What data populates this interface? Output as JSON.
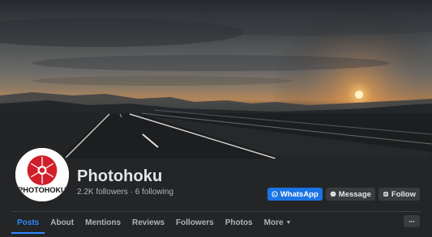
{
  "page": {
    "name": "Photohoku",
    "followers": "2.2K followers",
    "separator": "·",
    "following": "6 following",
    "avatar_text": "PHOTOHOKU"
  },
  "actions": {
    "whatsapp_label": "WhatsApp",
    "message_label": "Message",
    "follow_label": "Follow"
  },
  "tabs": [
    {
      "label": "Posts",
      "active": true
    },
    {
      "label": "About"
    },
    {
      "label": "Mentions"
    },
    {
      "label": "Reviews"
    },
    {
      "label": "Followers"
    },
    {
      "label": "Photos"
    },
    {
      "label": "More"
    }
  ],
  "more_button": "···",
  "icons": {
    "whatsapp": "whatsapp-icon",
    "message": "messenger-icon",
    "follow": "follow-icon",
    "more_caret": "caret-down-icon"
  },
  "colors": {
    "accent": "#2d88ff",
    "primary_button": "#1b74e4",
    "background": "#242526",
    "avatar_red": "#d01f2a"
  }
}
